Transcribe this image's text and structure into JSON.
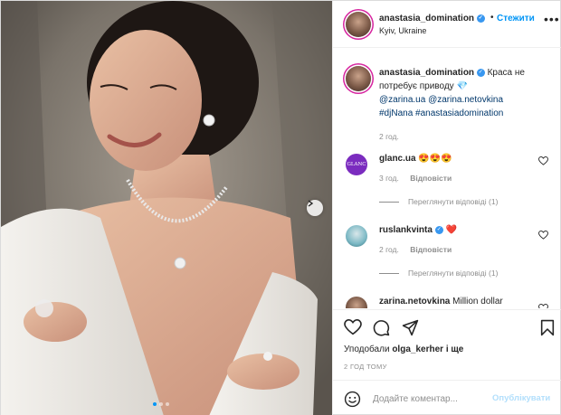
{
  "header": {
    "username": "anastasia_domination",
    "separator": "•",
    "follow_label": "Стежити",
    "location": "Kyiv, Ukraine",
    "more_icon": "more-options-icon"
  },
  "caption": {
    "username": "anastasia_domination",
    "text_1": "Краса не потребує приводу",
    "emoji": "💎",
    "mention_1": "@zarina.ua",
    "mention_2": "@zarina.netovkina",
    "hashtag_1": "#djNana",
    "hashtag_2": "#anastasiadomination",
    "time": "2 год."
  },
  "comments": [
    {
      "username": "glanc.ua",
      "text": "😍😍😍",
      "time": "3 год.",
      "reply_label": "Відповісти",
      "view_replies": "Переглянути відповіді (1)"
    },
    {
      "username": "ruslankvinta",
      "text": "❤️",
      "time": "2 год.",
      "reply_label": "Відповісти",
      "view_replies": "Переглянути відповіді (1)"
    },
    {
      "username": "zarina.netovkina",
      "text": "Million dollar"
    }
  ],
  "actions": {
    "likes_prefix": "Уподобали",
    "likes_user": "olga_kerher",
    "likes_suffix": "і ще",
    "post_time": "2 ГОД ТОМУ"
  },
  "add_comment": {
    "placeholder": "Додайте коментар...",
    "publish_label": "Опублікувати"
  },
  "carousel": {
    "total_slides": 3,
    "active_slide": 1
  },
  "colors": {
    "accent": "#0095f6",
    "link": "#00376b",
    "muted": "#8e8e8e",
    "verified": "#3897f0"
  }
}
